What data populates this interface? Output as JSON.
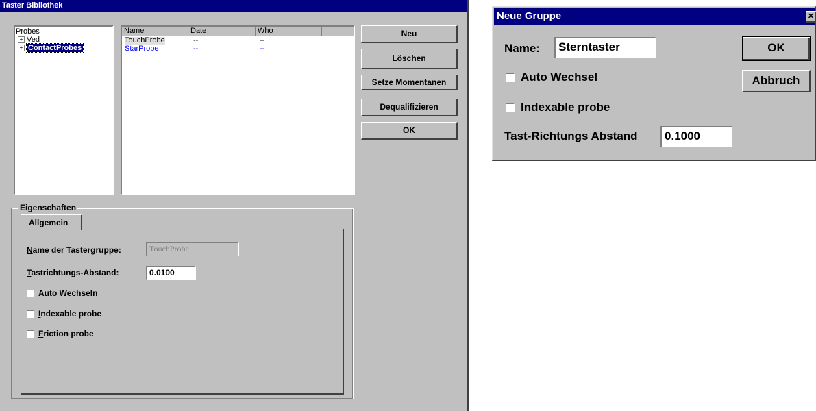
{
  "main_window": {
    "title": "Taster Bibliothek",
    "tree": {
      "root": "Probes",
      "items": [
        {
          "label": "Ved",
          "expander": "+"
        },
        {
          "label": "ContactProbes",
          "expander": "+",
          "selected": true
        }
      ]
    },
    "list": {
      "columns": [
        "Name",
        "Date",
        "Who"
      ],
      "rows": [
        {
          "name": "TouchProbe",
          "date": "--",
          "who": "--"
        },
        {
          "name": "StarProbe",
          "date": "--",
          "who": "--"
        }
      ]
    },
    "buttons": {
      "neu": "Neu",
      "loeschen": "Löschen",
      "setze": "Setze Momentanen",
      "dequal": "Dequalifizieren",
      "ok": "OK"
    },
    "properties": {
      "group_label": "Eigenschaften",
      "tab": "Allgemein",
      "name_label": "Name der Tastergruppe:",
      "name_value": "TouchProbe",
      "distance_label": "Tastrichtungs-Abstand:",
      "distance_value": "0.0100",
      "cb_auto": "Auto Wechseln",
      "cb_indexable": "Indexable probe",
      "cb_friction": "Friction probe"
    }
  },
  "dialog": {
    "title": "Neue Gruppe",
    "close_glyph": "✕",
    "name_label": "Name:",
    "name_value": "Sterntaster",
    "cb_auto": "Auto Wechsel",
    "cb_indexable": "Indexable probe",
    "distance_label": "Tast-Richtungs Abstand",
    "distance_value": "0.1000",
    "ok": "OK",
    "cancel": "Abbruch"
  },
  "colors": {
    "titlebar": "#000080",
    "face": "#c0c0c0",
    "link_blue": "#0000ff"
  }
}
